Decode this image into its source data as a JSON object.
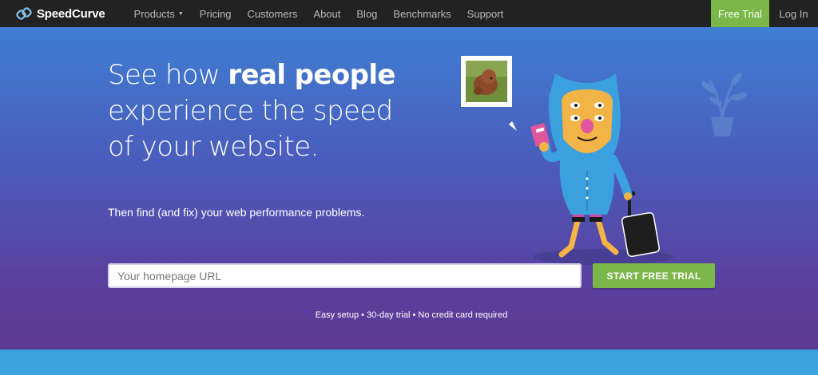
{
  "nav": {
    "logo_text": "SpeedCurve",
    "links": [
      {
        "label": "Products",
        "has_dropdown": true
      },
      {
        "label": "Pricing"
      },
      {
        "label": "Customers"
      },
      {
        "label": "About"
      },
      {
        "label": "Blog"
      },
      {
        "label": "Benchmarks"
      },
      {
        "label": "Support"
      }
    ],
    "free_trial_label": "Free Trial",
    "login_label": "Log In"
  },
  "hero": {
    "headline_pre": "See how ",
    "headline_bold": "real people",
    "headline_line2": "experience the speed",
    "headline_line3": "of your website.",
    "subhead": "Then find (and fix) your web performance problems.",
    "url_placeholder": "Your homepage URL",
    "url_value": "",
    "cta_label": "START FREE TRIAL",
    "fine_print": "Easy setup • 30-day trial • No credit card required"
  },
  "colors": {
    "nav_bg": "#222222",
    "accent_green": "#7ab648",
    "hero_top": "#3f7ed2",
    "hero_bottom": "#5e3a94",
    "bottom_band": "#3aa0de"
  },
  "icons": {
    "logo": "speedcurve-chain-icon",
    "dropdown": "caret-down-icon"
  }
}
